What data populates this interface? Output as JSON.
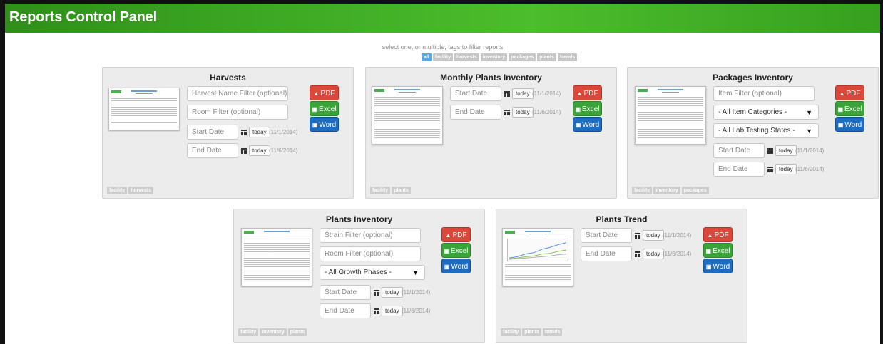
{
  "header": {
    "title": "Reports Control Panel",
    "brand_color": "#3da823"
  },
  "filter": {
    "hint": "select one, or multiple, tags to filter reports",
    "tags": [
      "all",
      "facility",
      "harvests",
      "inventory",
      "packages",
      "plants",
      "trends"
    ]
  },
  "date_defaults": {
    "start": "Start Date",
    "end": "End Date",
    "today": "today",
    "start_hint": "(11/1/2014)",
    "end_hint": "(11/6/2014)"
  },
  "buttons": {
    "pdf": "PDF",
    "excel": "Excel",
    "word": "Word"
  },
  "reports": [
    {
      "title": "Harvests",
      "inputs": [
        "Harvest Name Filter (optional)",
        "Room Filter (optional)"
      ],
      "tags": [
        "facility",
        "harvests"
      ]
    },
    {
      "title": "Monthly Plants Inventory",
      "tags": [
        "facility",
        "plants"
      ]
    },
    {
      "title": "Packages Inventory",
      "inputs": [
        "Item Filter (optional)"
      ],
      "selects": [
        "- All Item Categories -",
        "- All Lab Testing States -"
      ],
      "tags": [
        "facility",
        "inventory",
        "packages"
      ]
    },
    {
      "title": "Plants Inventory",
      "inputs": [
        "Strain Filter (optional)",
        "Room Filter (optional)"
      ],
      "selects": [
        "- All Growth Phases -"
      ],
      "tags": [
        "facility",
        "inventory",
        "plants"
      ]
    },
    {
      "title": "Plants Trend",
      "tags": [
        "facility",
        "plants",
        "trends"
      ]
    }
  ]
}
